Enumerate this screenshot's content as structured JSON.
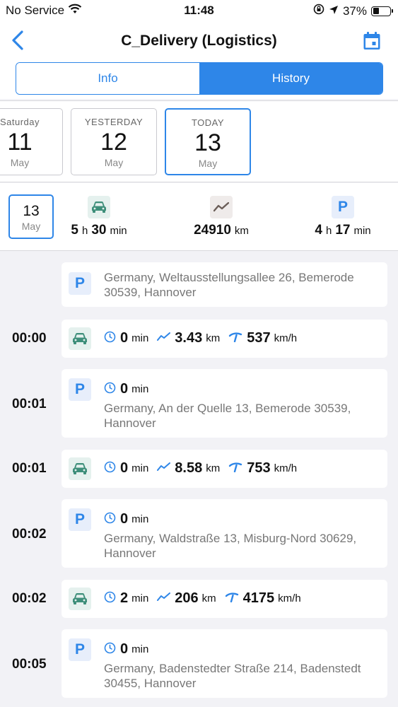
{
  "status_bar": {
    "carrier": "No Service",
    "time": "11:48",
    "battery": "37%"
  },
  "nav": {
    "title": "C_Delivery (Logistics)"
  },
  "tabs": {
    "info": "Info",
    "history": "History",
    "selected": "History"
  },
  "dates": [
    {
      "name": "Saturday",
      "day": "11",
      "month": "May"
    },
    {
      "name": "YESTERDAY",
      "day": "12",
      "month": "May"
    },
    {
      "name": "TODAY",
      "day": "13",
      "month": "May"
    }
  ],
  "summary": {
    "day": "13",
    "month": "May",
    "drive_h": "5",
    "drive_h_unit": "h",
    "drive_m": "30",
    "drive_m_unit": "min",
    "distance": "24910",
    "distance_unit": "km",
    "park_h": "4",
    "park_h_unit": "h",
    "park_m": "17",
    "park_m_unit": "min"
  },
  "timeline": [
    {
      "time": "",
      "type": "parking",
      "address": "Germany, Weltausstellungsallee 26, Bemerode 30539, Hannover"
    },
    {
      "time": "00:00",
      "type": "driving",
      "duration": "0",
      "duration_unit": "min",
      "distance": "3.43",
      "distance_unit": "km",
      "speed": "537",
      "speed_unit": "km/h"
    },
    {
      "time": "00:01",
      "type": "parking",
      "duration": "0",
      "duration_unit": "min",
      "address": "Germany, An der Quelle 13, Bemerode 30539, Hannover"
    },
    {
      "time": "00:01",
      "type": "driving",
      "duration": "0",
      "duration_unit": "min",
      "distance": "8.58",
      "distance_unit": "km",
      "speed": "753",
      "speed_unit": "km/h"
    },
    {
      "time": "00:02",
      "type": "parking",
      "duration": "0",
      "duration_unit": "min",
      "address": "Germany, Waldstraße 13, Misburg-Nord 30629, Hannover"
    },
    {
      "time": "00:02",
      "type": "driving",
      "duration": "2",
      "duration_unit": "min",
      "distance": "206",
      "distance_unit": "km",
      "speed": "4175",
      "speed_unit": "km/h"
    },
    {
      "time": "00:05",
      "type": "parking",
      "duration": "0",
      "duration_unit": "min",
      "address": "Germany, Badenstedter Straße 214, Badenstedt 30455, Hannover"
    }
  ],
  "colors": {
    "accent": "#2e86e8",
    "car": "#3e8f7a",
    "background": "#f2f2f6"
  }
}
